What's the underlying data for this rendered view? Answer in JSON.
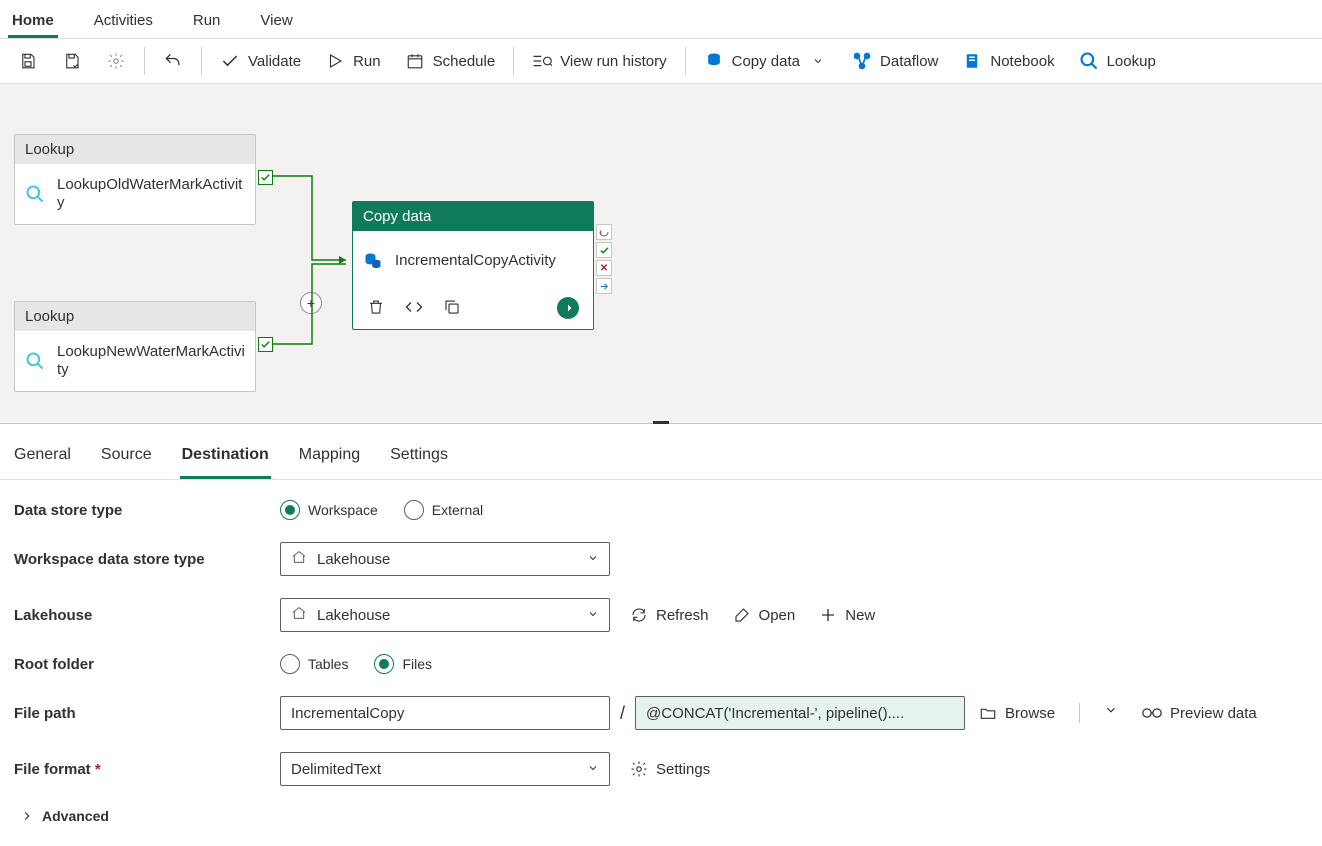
{
  "top_tabs": [
    "Home",
    "Activities",
    "Run",
    "View"
  ],
  "top_tab_active": 0,
  "toolbar": {
    "validate": "Validate",
    "run": "Run",
    "schedule": "Schedule",
    "view_run_history": "View run history",
    "copy_data": "Copy data",
    "dataflow": "Dataflow",
    "notebook": "Notebook",
    "lookup": "Lookup"
  },
  "canvas": {
    "activities": [
      {
        "type": "Lookup",
        "name": "LookupOldWaterMarkActivity"
      },
      {
        "type": "Lookup",
        "name": "LookupNewWaterMarkActivity"
      },
      {
        "type": "Copy data",
        "name": "IncrementalCopyActivity"
      }
    ]
  },
  "lower_tabs": [
    "General",
    "Source",
    "Destination",
    "Mapping",
    "Settings"
  ],
  "lower_tab_active": 2,
  "form": {
    "data_store_type": {
      "label": "Data store type",
      "options": [
        "Workspace",
        "External"
      ],
      "selected": 0
    },
    "workspace_ds_type": {
      "label": "Workspace data store type",
      "value": "Lakehouse"
    },
    "lakehouse": {
      "label": "Lakehouse",
      "value": "Lakehouse",
      "actions": {
        "refresh": "Refresh",
        "open": "Open",
        "new": "New"
      }
    },
    "root_folder": {
      "label": "Root folder",
      "options": [
        "Tables",
        "Files"
      ],
      "selected": 1
    },
    "file_path": {
      "label": "File path",
      "folder": "IncrementalCopy",
      "file_expr": "@CONCAT('Incremental-', pipeline()....",
      "browse": "Browse",
      "preview": "Preview data"
    },
    "file_format": {
      "label": "File format",
      "value": "DelimitedText",
      "settings": "Settings"
    },
    "advanced": "Advanced"
  }
}
